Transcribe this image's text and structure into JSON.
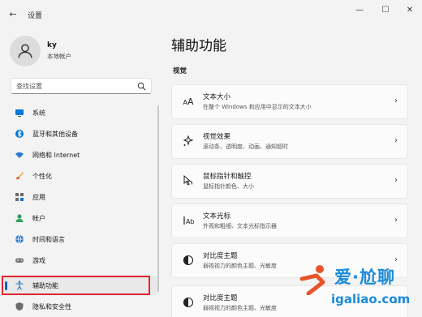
{
  "window": {
    "title": "设置",
    "back": "←",
    "minimize": "—",
    "maximize": "☐",
    "close": "✕"
  },
  "profile": {
    "name": "ky",
    "account_type": "本地帐户"
  },
  "search": {
    "placeholder": "查找设置"
  },
  "sidebar": {
    "items": [
      {
        "label": "系统",
        "icon": "monitor-icon"
      },
      {
        "label": "蓝牙和其他设备",
        "icon": "bluetooth-icon"
      },
      {
        "label": "网络和 Internet",
        "icon": "wifi-icon"
      },
      {
        "label": "个性化",
        "icon": "brush-icon"
      },
      {
        "label": "应用",
        "icon": "apps-icon"
      },
      {
        "label": "帐户",
        "icon": "person-icon"
      },
      {
        "label": "时间和语言",
        "icon": "globe-icon"
      },
      {
        "label": "游戏",
        "icon": "gamepad-icon"
      },
      {
        "label": "辅助功能",
        "icon": "accessibility-icon",
        "active": true
      },
      {
        "label": "隐私和安全性",
        "icon": "shield-icon"
      }
    ]
  },
  "main": {
    "title": "辅助功能",
    "section": "视觉",
    "cards": [
      {
        "title": "文本大小",
        "subtitle": "在整个 Windows 和应用中显示的文本大小",
        "icon": "text-size-icon"
      },
      {
        "title": "视觉效果",
        "subtitle": "滚动条、透明度、动画、通知超时",
        "icon": "sparkle-icon"
      },
      {
        "title": "鼠标指针和触控",
        "subtitle": "鼠标指针颜色、大小",
        "icon": "pointer-icon"
      },
      {
        "title": "文本光标",
        "subtitle": "外观和粗细、文本光标指示器",
        "icon": "text-cursor-icon"
      },
      {
        "title": "对比度主题",
        "subtitle": "弱视视力的颜色主题、光敏度",
        "icon": "contrast-icon"
      },
      {
        "title": "对比度主题",
        "subtitle": "弱视视力的颜色主题、光敏度",
        "icon": "contrast-icon"
      }
    ]
  },
  "watermark": {
    "brand": "爱·尬聊",
    "url": "igaliao.com"
  },
  "colors": {
    "accent": "#0067c0",
    "highlight_border": "#e0262f",
    "watermark": "#1a8bd8"
  }
}
